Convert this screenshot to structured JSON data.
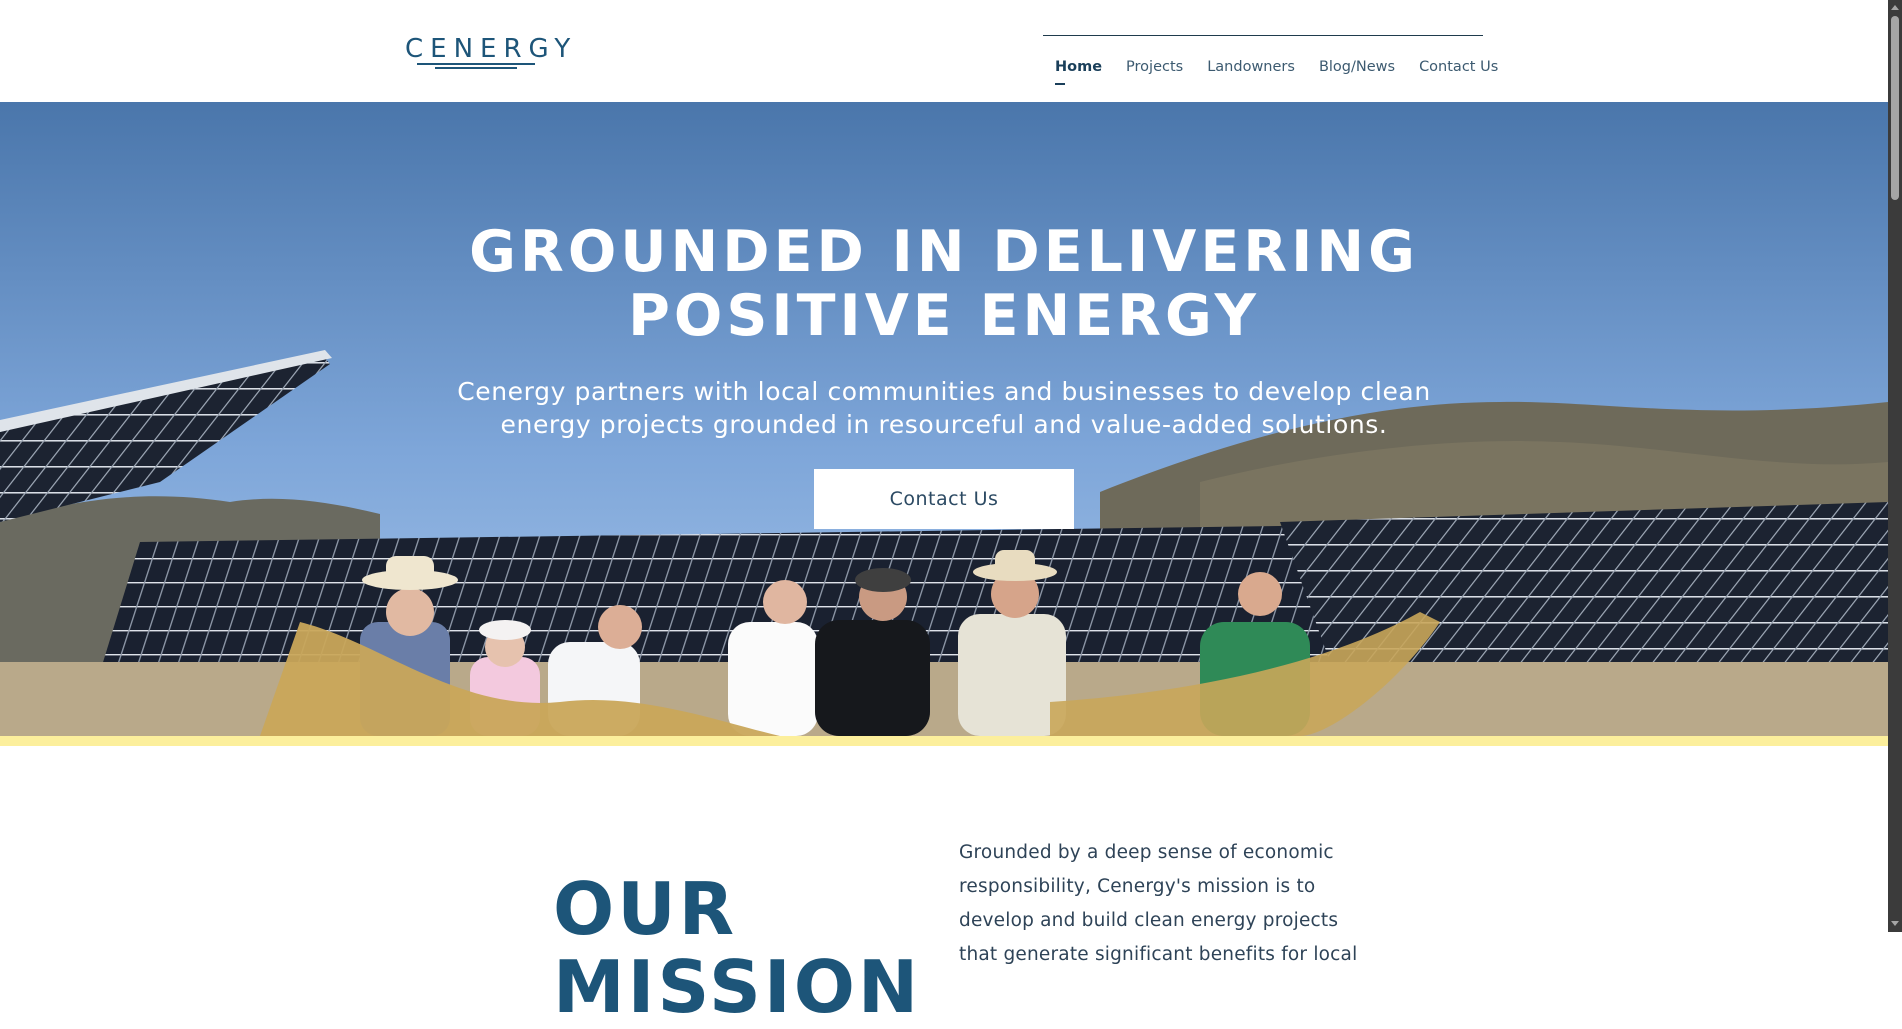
{
  "header": {
    "logo_text": "CENERGY",
    "nav": [
      {
        "label": "Home",
        "active": true
      },
      {
        "label": "Projects",
        "active": false
      },
      {
        "label": "Landowners",
        "active": false
      },
      {
        "label": "Blog/News",
        "active": false
      },
      {
        "label": "Contact Us",
        "active": false
      }
    ]
  },
  "hero": {
    "title_lines": [
      "GROUNDED IN DELIVERING",
      "POSITIVE ENERGY"
    ],
    "subtitle_lines": [
      "Cenergy partners with local communities and businesses to develop clean",
      "energy projects grounded in resourceful and value-added solutions."
    ],
    "cta_label": "Contact Us"
  },
  "mission": {
    "heading_lines": [
      "OUR",
      "MISSION"
    ],
    "text_lines": [
      "Grounded by a deep sense of economic",
      "responsibility, Cenergy's mission is to",
      "develop and build clean energy projects",
      "that generate significant benefits for local"
    ]
  },
  "colors": {
    "brand_blue": "#1d5579",
    "nav_text": "#3c5a70",
    "accent_yellow": "#fcef9c",
    "sky_top": "#4b78ac",
    "sky_bottom": "#8fb4e0"
  }
}
